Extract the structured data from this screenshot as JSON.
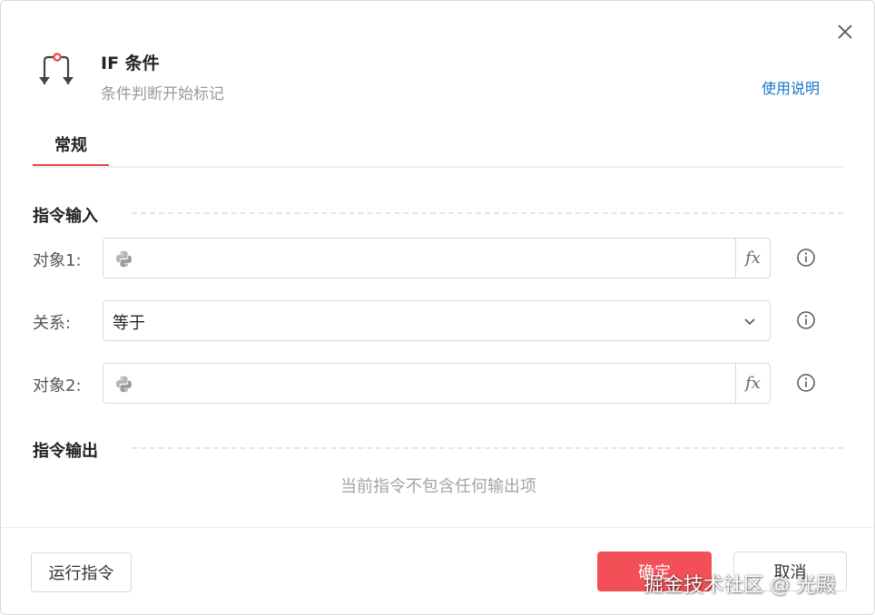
{
  "dialog": {
    "title": "IF 条件",
    "subtitle": "条件判断开始标记",
    "help_link": "使用说明",
    "icons": {
      "header": "if-condition-icon",
      "close": "close-icon"
    }
  },
  "tabs": [
    {
      "label": "常规",
      "active": true
    }
  ],
  "sections": {
    "input_title": "指令输入",
    "output_title": "指令输出",
    "output_empty": "当前指令不包含任何输出项"
  },
  "fields": {
    "object1": {
      "label": "对象1:",
      "value": "",
      "fx": "fx"
    },
    "relation": {
      "label": "关系:",
      "value": "等于"
    },
    "object2": {
      "label": "对象2:",
      "value": "",
      "fx": "fx"
    }
  },
  "footer": {
    "run_label": "运行指令",
    "ok_label": "确定",
    "cancel_label": "取消"
  },
  "watermark": "掘金技术社区 @ 光殿",
  "colors": {
    "accent": "#e8474b",
    "primary_button": "#f25056",
    "link": "#1677c8"
  }
}
